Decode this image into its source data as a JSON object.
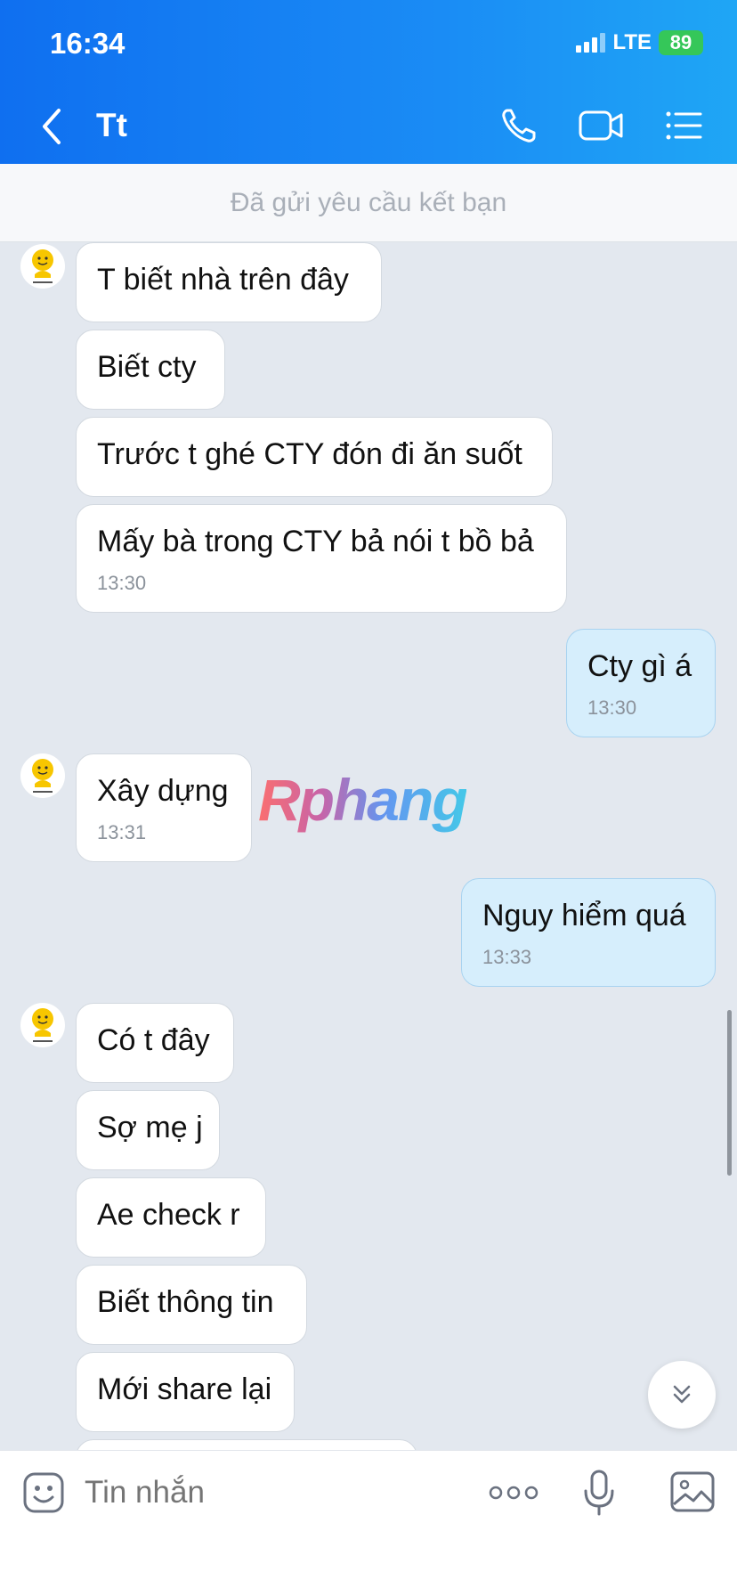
{
  "status_bar": {
    "time": "16:34",
    "network": "LTE",
    "battery": "89"
  },
  "header": {
    "title": "Tt",
    "back_icon": "chevron-left-icon",
    "call_icon": "phone-icon",
    "video_icon": "video-camera-icon",
    "menu_icon": "list-menu-icon"
  },
  "friend_request_banner": "Đã gửi yêu cầu kết bạn",
  "messages": [
    {
      "from": "other",
      "text": "T biết nhà trên đây"
    },
    {
      "from": "other",
      "text": "Biết cty"
    },
    {
      "from": "other",
      "text": "Trước t ghé CTY đón đi ăn suốt"
    },
    {
      "from": "other",
      "text": "Mấy bà trong CTY bả nói t bồ bả",
      "time": "13:30"
    },
    {
      "from": "me",
      "text": "Cty gì á",
      "time": "13:30"
    },
    {
      "from": "other",
      "text": "Xây dựng",
      "time": "13:31"
    },
    {
      "from": "me",
      "text": "Nguy hiểm quá",
      "time": "13:33"
    },
    {
      "from": "other",
      "text": "Có t đây"
    },
    {
      "from": "other",
      "text": "Sợ mẹ j"
    },
    {
      "from": "other",
      "text": "Ae check r"
    },
    {
      "from": "other",
      "text": "Biết thông tin"
    },
    {
      "from": "other",
      "text": "Mới share lại"
    }
  ],
  "watermark": "Rphang",
  "composer": {
    "placeholder": "Tin nhắn",
    "emoji_icon": "emoji-icon",
    "more_icon": "more-dots-icon",
    "mic_icon": "microphone-icon",
    "image_icon": "image-icon"
  },
  "colors": {
    "header_start": "#0f6ff0",
    "header_end": "#1fa6f5",
    "my_bubble": "#d6eefc",
    "chat_bg": "#e3e8ef"
  }
}
